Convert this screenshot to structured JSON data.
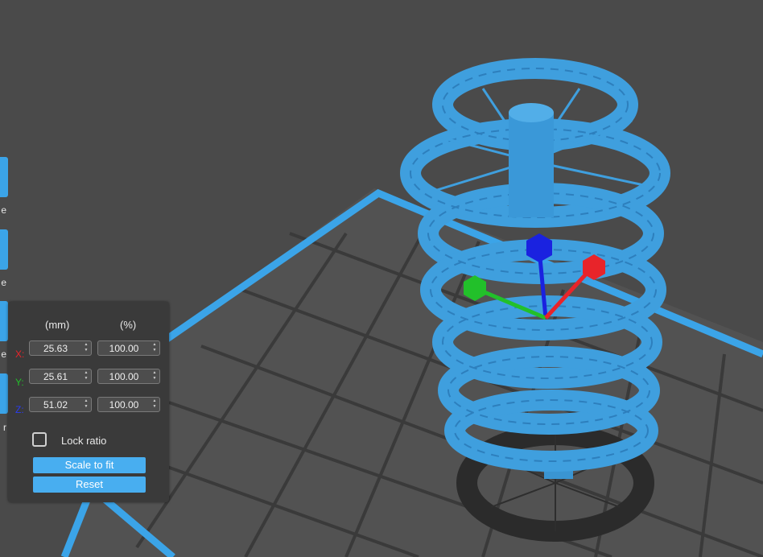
{
  "colors": {
    "background": "#4a4a4a",
    "bed": "#3ba4e8",
    "model": "#3f9fde",
    "x_axis": "#e8242a",
    "y_axis": "#22c02a",
    "z_axis": "#1a22e0",
    "panel": "#3a3a3a",
    "button": "#48aef0"
  },
  "toolbar": {
    "labels": [
      "e",
      "e",
      "e",
      "r"
    ]
  },
  "scale_panel": {
    "col_mm": "(mm)",
    "col_pct": "(%)",
    "rows": [
      {
        "axis": "X:",
        "mm": "25.63",
        "pct": "100.00"
      },
      {
        "axis": "Y:",
        "mm": "25.61",
        "pct": "100.00"
      },
      {
        "axis": "Z:",
        "mm": "51.02",
        "pct": "100.00"
      }
    ],
    "lock_ratio_label": "Lock ratio",
    "lock_ratio_checked": false,
    "scale_to_fit_label": "Scale to fit",
    "reset_label": "Reset"
  }
}
